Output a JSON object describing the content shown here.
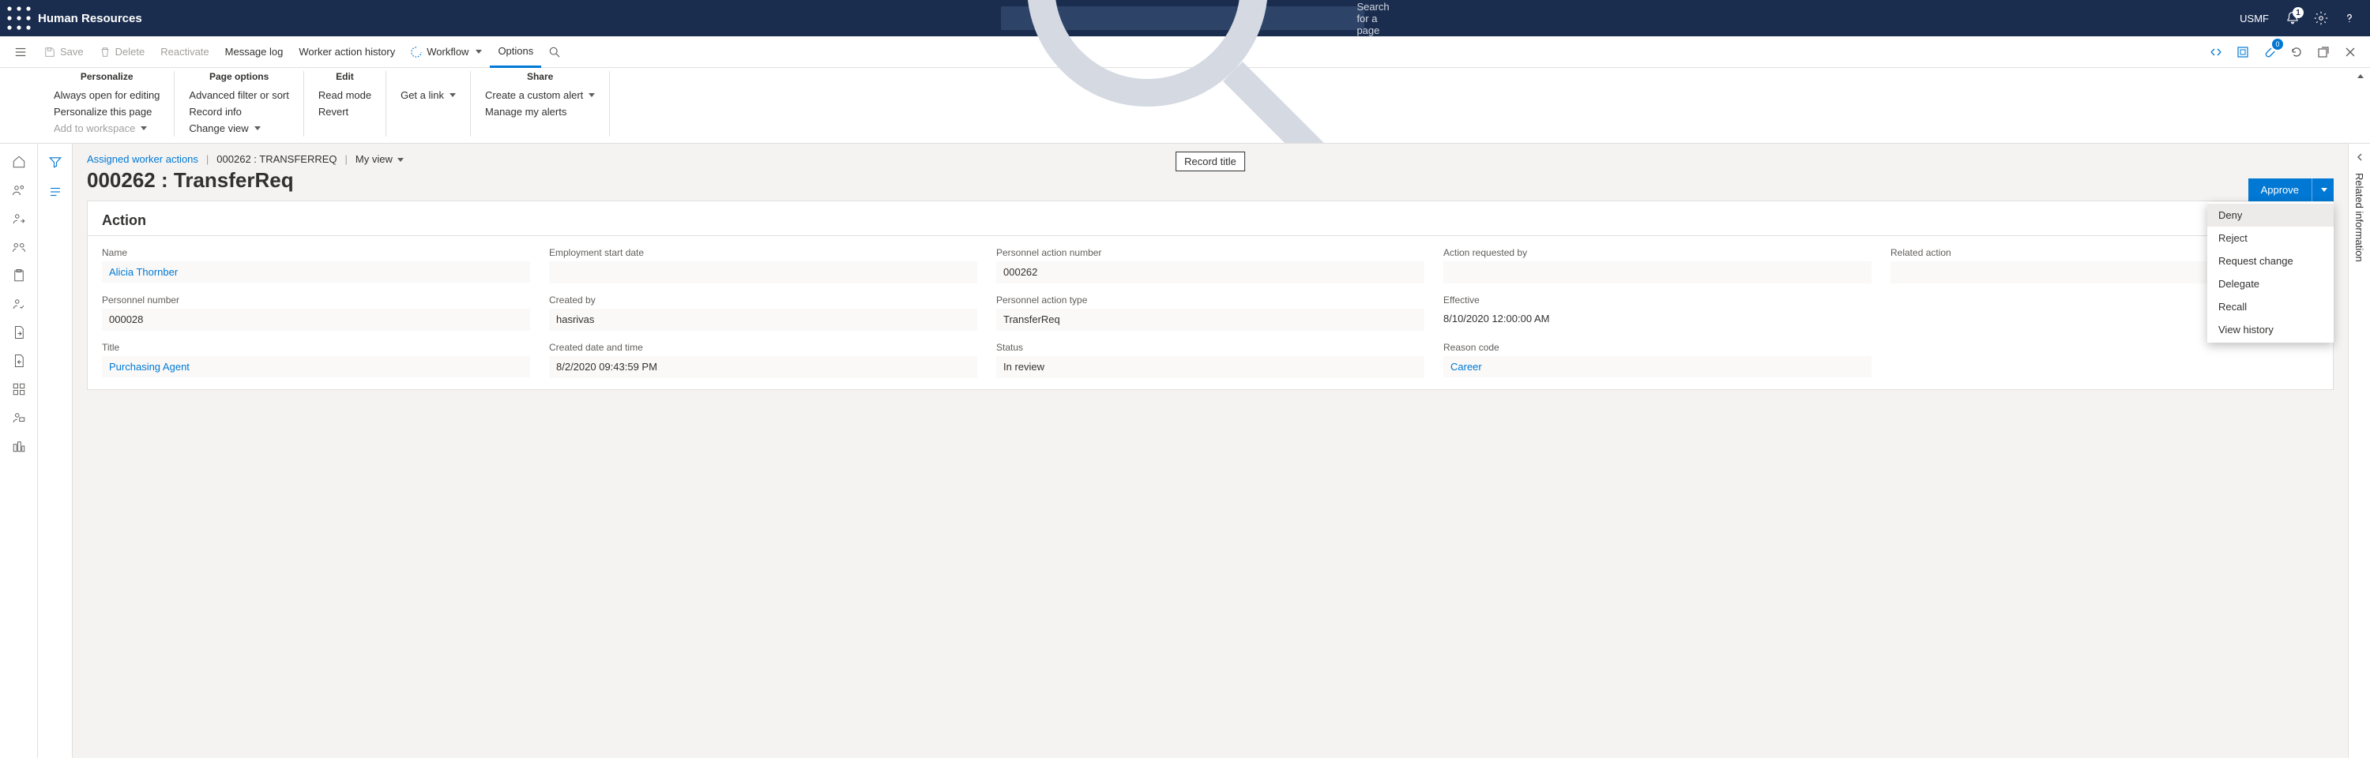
{
  "topbar": {
    "title": "Human Resources",
    "search_placeholder": "Search for a page",
    "entity": "USMF",
    "notification_count": "1"
  },
  "commandbar": {
    "save": "Save",
    "delete": "Delete",
    "reactivate": "Reactivate",
    "message_log": "Message log",
    "worker_action_history": "Worker action history",
    "workflow": "Workflow",
    "options": "Options",
    "attachment_count": "0"
  },
  "ribbon": {
    "personalize": {
      "title": "Personalize",
      "items": [
        "Always open for editing",
        "Personalize this page",
        "Add to workspace"
      ]
    },
    "page_options": {
      "title": "Page options",
      "items": [
        "Advanced filter or sort",
        "Record info",
        "Change view"
      ]
    },
    "edit": {
      "title": "Edit",
      "items": [
        "Read mode",
        "Revert"
      ]
    },
    "get_link": {
      "title": "",
      "items": [
        "Get a link"
      ]
    },
    "share": {
      "title": "Share",
      "items": [
        "Create a custom alert",
        "Manage my alerts"
      ]
    }
  },
  "breadcrumb": {
    "root": "Assigned worker actions",
    "record": "000262 : TRANSFERREQ",
    "view": "My view"
  },
  "record_title_tooltip": "Record title",
  "page_title": "000262 : TransferReq",
  "approve": {
    "label": "Approve",
    "menu": [
      "Deny",
      "Reject",
      "Request change",
      "Delegate",
      "Recall",
      "View history"
    ]
  },
  "card": {
    "heading": "Action",
    "timestamp": "8/10/2020 12:0",
    "fields": {
      "name": {
        "label": "Name",
        "value": "Alicia Thornber"
      },
      "personnel_number": {
        "label": "Personnel number",
        "value": "000028"
      },
      "title": {
        "label": "Title",
        "value": "Purchasing Agent"
      },
      "employment_start_date": {
        "label": "Employment start date",
        "value": ""
      },
      "created_by": {
        "label": "Created by",
        "value": "hasrivas"
      },
      "created_date_time": {
        "label": "Created date and time",
        "value": "8/2/2020 09:43:59 PM"
      },
      "personnel_action_number": {
        "label": "Personnel action number",
        "value": "000262"
      },
      "personnel_action_type": {
        "label": "Personnel action type",
        "value": "TransferReq"
      },
      "status": {
        "label": "Status",
        "value": "In review"
      },
      "action_requested_by": {
        "label": "Action requested by",
        "value": ""
      },
      "effective": {
        "label": "Effective",
        "value": "8/10/2020 12:00:00 AM"
      },
      "reason_code": {
        "label": "Reason code",
        "value": "Career"
      },
      "related_action": {
        "label": "Related action",
        "value": ""
      }
    }
  },
  "right_rail": {
    "label": "Related information"
  }
}
